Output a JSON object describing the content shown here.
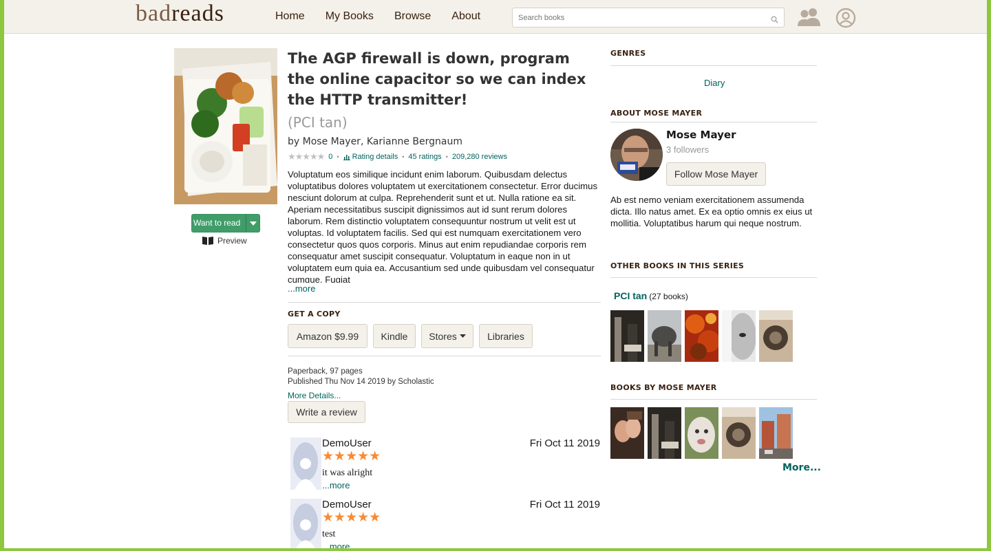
{
  "header": {
    "logo_prefix": "bad",
    "logo_suffix": "reads",
    "nav": [
      "Home",
      "My Books",
      "Browse",
      "About"
    ],
    "search_placeholder": "Search books"
  },
  "book": {
    "title": "The AGP firewall is down, program the online capacitor so we can index the HTTP transmitter!",
    "series": "(PCI tan)",
    "by": "by",
    "authors": [
      "Mose Mayer,",
      "Karianne Bergnaum"
    ],
    "avg_rating": "0",
    "rating_details": "Rating details",
    "ratings": "45 ratings",
    "reviews": "209,280 reviews",
    "description": "Voluptatum eos similique incidunt enim laborum. Quibusdam delectus voluptatibus dolores voluptatem ut exercitationem consectetur. Error ducimus nesciunt dolorum at culpa. Reprehenderit sunt et ut. Nulla ratione ea sit. Aperiam necessitatibus suscipit dignissimos aut id sunt rerum dolores laborum. Rem distinctio voluptatem consequuntur nostrum ut velit est ut voluptas. Id voluptatem facilis. Sed qui est numquam exercitationem vero consectetur quos quos corporis. Minus aut enim repudiandae corporis rem consequatur amet suscipit consequatur. Voluptatum in eaque non in ut voluptatem eum quia ea. Accusantium sed unde quibusdam vel consequatur cumque. Fugiat",
    "more": "...more",
    "want_to_read": "Want to read",
    "preview": "Preview"
  },
  "get_copy": {
    "heading": "GET A COPY",
    "buttons": [
      "Amazon $9.99",
      "Kindle",
      "Stores",
      "Libraries"
    ]
  },
  "details": {
    "format": "Paperback, 97 pages",
    "published": "Published Thu Nov 14 2019 by Scholastic",
    "more_details": "More Details...",
    "write_review": "Write a review"
  },
  "reviews": [
    {
      "user": "DemoUser",
      "date": "Fri Oct 11 2019",
      "stars": 5,
      "text": "it was alright",
      "more": "...more"
    },
    {
      "user": "DemoUser",
      "date": "Fri Oct 11 2019",
      "stars": 5,
      "text": "test",
      "more": "...more"
    }
  ],
  "sidebar": {
    "genres_heading": "GENRES",
    "genre": "Diary",
    "about_heading": "ABOUT MOSE MAYER",
    "author_name": "Mose Mayer",
    "followers": "3 followers",
    "follow_button": "Follow Mose Mayer",
    "author_bio": "Ab est nemo veniam exercitationem assumenda dicta. Illo natus amet. Ex ea optio omnis ex eius ut mollitia. Voluptatibus harum qui neque nostrum.",
    "series_heading": "OTHER BOOKS IN THIS SERIES",
    "series_name": "PCI tan",
    "series_count": "(27 books)",
    "books_by_heading": "BOOKS BY MOSE MAYER",
    "more": "More..."
  },
  "colors": {
    "link": "#00635d",
    "header_bg": "#f4f1ea",
    "green_button": "#409d69",
    "star_orange": "#fa8a31"
  }
}
